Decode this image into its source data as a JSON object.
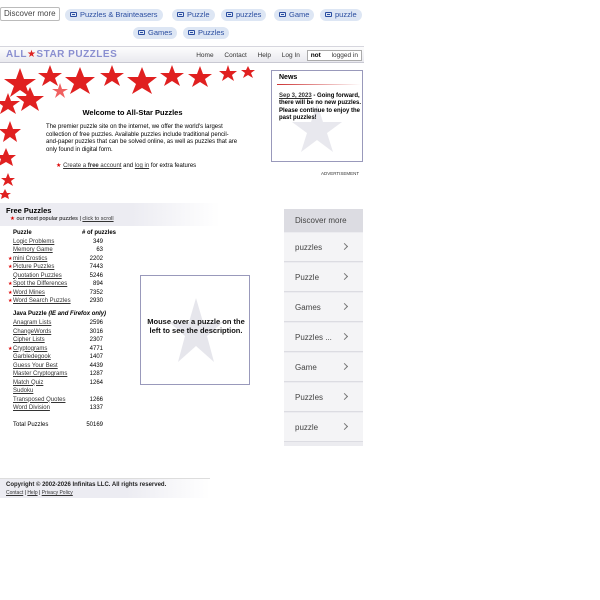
{
  "chips": {
    "discover": "Discover more",
    "row1": [
      "Puzzles & Brainteasers",
      "Puzzle",
      "puzzles",
      "Game",
      "puzzle"
    ],
    "row2": [
      "Games",
      "Puzzles"
    ]
  },
  "header": {
    "logo_left": "ALL",
    "logo_right": "STAR PUZZLES",
    "nav": [
      "Home",
      "Contact",
      "Help",
      "Log In"
    ],
    "login_not": "not",
    "login_rest": " logged in"
  },
  "welcome": {
    "title": "Welcome to All-Star Puzzles",
    "text": "The premier puzzle site on the internet, we offer the world's largest collection of free puzzles. Available puzzles include traditional pencil-and-paper puzzles that can be solved online, as well as puzzles that are only found in digital form.",
    "create_pre": "Create a ",
    "create_free": "free",
    "create_post": " account",
    "and": " and ",
    "login": "log in",
    "extra": " for extra features"
  },
  "news": {
    "title": "News",
    "date": "Sep 3, 2023",
    "body": " - Going forward, there will be no new puzzles. Please continue to enjoy the past puzzles!"
  },
  "advertisement": "ADVERTISEMENT",
  "free_puzzles": {
    "title": "Free Puzzles",
    "popular": " our most popular puzzles | ",
    "scroll": "click to scroll",
    "col_puzzle": "Puzzle",
    "col_count": "# of puzzles",
    "rows": [
      {
        "name": "Logic Problems",
        "count": "349",
        "star": false
      },
      {
        "name": "Memory Game",
        "count": "63",
        "star": false
      },
      {
        "name": "mini Crostics",
        "count": "2202",
        "star": true
      },
      {
        "name": "Picture Puzzles",
        "count": "7443",
        "star": true
      },
      {
        "name": "Quotation Puzzles",
        "count": "5246",
        "star": false
      },
      {
        "name": "Spot the Differences",
        "count": "894",
        "star": true
      },
      {
        "name": "Word Mines",
        "count": "7352",
        "star": true
      },
      {
        "name": "Word Search Puzzles",
        "count": "2930",
        "star": true
      }
    ],
    "java_title": "Java Puzzle",
    "java_note": " (IE and Firefox only)",
    "java_rows": [
      {
        "name": "Anagram Lists",
        "count": "2596",
        "star": false
      },
      {
        "name": "ChangeWords",
        "count": "3016",
        "star": false
      },
      {
        "name": "Cipher Lists",
        "count": "2307",
        "star": false
      },
      {
        "name": "Cryptograms",
        "count": "4771",
        "star": true
      },
      {
        "name": "Garbledegook",
        "count": "1407",
        "star": false
      },
      {
        "name": "Guess Your Best",
        "count": "4439",
        "star": false
      },
      {
        "name": "Master Cryptograms",
        "count": "1287",
        "star": false
      },
      {
        "name": "Match Quiz",
        "count": "1264",
        "star": false
      },
      {
        "name": "Sudoku",
        "count": "",
        "star": false
      },
      {
        "name": "Transposed Quotes",
        "count": "1266",
        "star": false
      },
      {
        "name": "Word Division",
        "count": "1337",
        "star": false
      }
    ],
    "total_label": "Total Puzzles",
    "total_count": "50169"
  },
  "description_box": "Mouse over a puzzle on the left to see the description.",
  "discover_panel": {
    "title": "Discover more",
    "items": [
      "puzzles",
      "Puzzle",
      "Games",
      "Puzzles ...",
      "Game",
      "Puzzles",
      "puzzle"
    ]
  },
  "footer": {
    "copyright": "Copyright © 2002-2026 Infinitas LLC. All rights reserved.",
    "links": [
      "Contact",
      "Help",
      "Privacy Policy"
    ]
  },
  "colors": {
    "star_red": "#dd1111",
    "chip_bg": "#dde6f4",
    "chip_text": "#2a4da0"
  }
}
